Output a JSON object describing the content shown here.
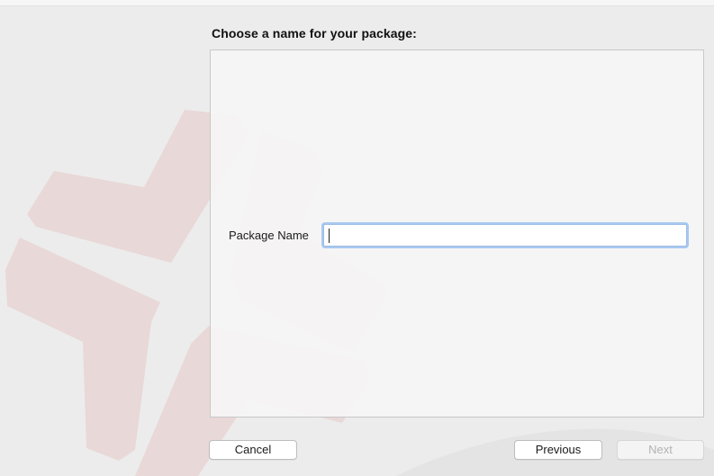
{
  "heading": "Choose a name for your package:",
  "form": {
    "package_name_label": "Package Name",
    "package_name_value": ""
  },
  "buttons": {
    "cancel": "Cancel",
    "previous": "Previous",
    "next": "Next",
    "next_enabled": false
  },
  "colors": {
    "background": "#ececec",
    "panel": "#f6f6f6",
    "focus_ring": "#a8c8f0",
    "logo_tint": "#f0d6d6"
  }
}
